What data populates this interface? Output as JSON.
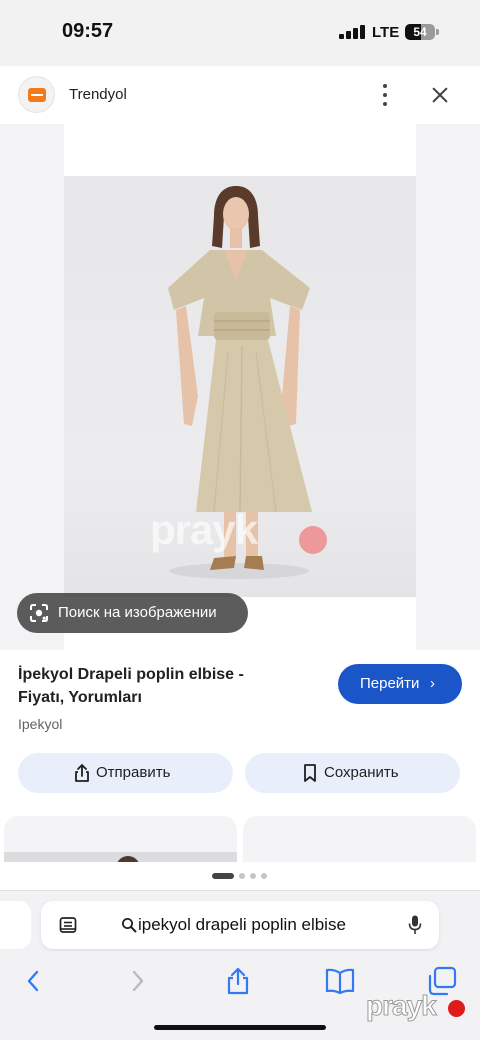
{
  "status_bar": {
    "time": "09:57",
    "network": "LTE",
    "battery": "54",
    "battery_level": 0.54
  },
  "site": {
    "name": "Trendyol",
    "icon": "trendyol-logo-icon"
  },
  "image": {
    "watermark": "prayk",
    "lens_chip_label": "Поиск на изображении"
  },
  "product": {
    "title_line1": "İpekyol Drapeli poplin elbise -",
    "title_line2": "Fiyatı, Yorumları",
    "source": "Ipekyol",
    "go_label": "Перейти",
    "go_chevron": "›",
    "share_label": "Отправить",
    "save_label": "Сохранить"
  },
  "pager": {
    "pages": 4,
    "active_index": 0
  },
  "safari": {
    "address_text": "ipekyol drapeli poplin elbise"
  },
  "overlay_watermark": "prayk",
  "colors": {
    "primary_button": "#1a56c7",
    "tonal_button": "#e8effb",
    "brand_orange": "#f27a1a"
  }
}
